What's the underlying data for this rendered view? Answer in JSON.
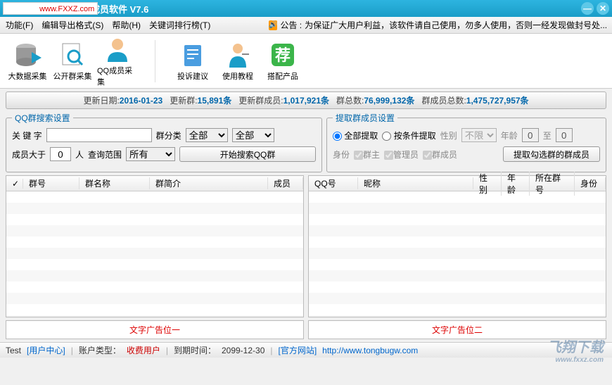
{
  "watermark": {
    "label": "飞翔下载",
    "url": "www.FXXZ.com"
  },
  "title": "群成员软件   V7.6",
  "menu": {
    "func": "功能(F)",
    "edit": "编辑导出格式(S)",
    "help": "帮助(H)",
    "rank": "关键词排行榜(T)"
  },
  "announce": {
    "prefix": "公告 :",
    "text": "为保证广大用户利益，该软件请自己使用，勿多人使用，否则一经发现做封号处..."
  },
  "toolbar": {
    "bigdata": "大数据采集",
    "public": "公开群采集",
    "qq": "QQ成员采集",
    "complain": "投诉建议",
    "tutorial": "使用教程",
    "match": "搭配产品"
  },
  "stats": {
    "update_label": "更新日期:",
    "update_val": "2016-01-23",
    "newgroup_label": "更新群:",
    "newgroup_val": "15,891条",
    "newmember_label": "更新群成员:",
    "newmember_val": "1,017,921条",
    "grouptotal_label": "群总数:",
    "grouptotal_val": "76,999,132条",
    "membertotal_label": "群成员总数:",
    "membertotal_val": "1,475,727,957条"
  },
  "left": {
    "legend": "QQ群搜索设置",
    "keyword_label": "关 键 字",
    "cat_label": "群分类",
    "cat_v1": "全部",
    "cat_v2": "全部",
    "gt_label": "成员大于",
    "gt_val": "0",
    "gt_unit": "人",
    "scope_label": "查询范围",
    "scope_val": "所有",
    "search_btn": "开始搜索QQ群",
    "cols": {
      "id": "群号",
      "name": "群名称",
      "intro": "群简介",
      "members": "成员"
    }
  },
  "right": {
    "legend": "提取群成员设置",
    "radio_all": "全部提取",
    "radio_cond": "按条件提取",
    "gender_label": "性别",
    "gender_val": "不限",
    "age_label": "年龄",
    "age_from": "0",
    "age_to_label": "至",
    "age_to": "0",
    "role_label": "身份",
    "role_owner": "群主",
    "role_admin": "管理员",
    "role_member": "群成员",
    "extract_btn": "提取勾选群的群成员",
    "cols": {
      "qq": "QQ号",
      "nick": "昵称",
      "gender": "性别",
      "age": "年龄",
      "group": "所在群号",
      "role": "身份"
    }
  },
  "ads": {
    "ad1": "文字广告位一",
    "ad2": "文字广告位二"
  },
  "status": {
    "user": "Test",
    "user_center": "[用户中心]",
    "acct_label": "账户类型：",
    "acct_val": "收费用户",
    "expire_label": "到期时间：",
    "expire_val": "2099-12-30",
    "site_label": "[官方网站]",
    "site_url": "http://www.tongbugw.com"
  },
  "brand": {
    "name": "飞翔下载",
    "url": "www.fxxz.com"
  }
}
